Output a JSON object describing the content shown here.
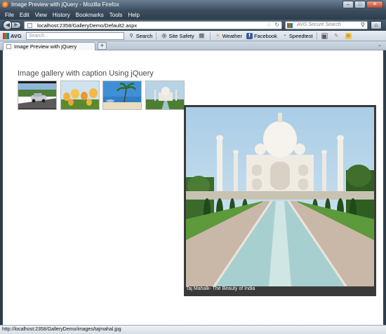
{
  "window": {
    "title": "Image Preview with jQuery - Mozilla Firefox",
    "buttons": {
      "minimize": "–",
      "maximize": "□",
      "close": "✕"
    }
  },
  "menubar": {
    "items": [
      "File",
      "Edit",
      "View",
      "History",
      "Bookmarks",
      "Tools",
      "Help"
    ]
  },
  "navbar": {
    "url": "localhost:2358/GalleryDemo/Default2.aspx",
    "search_placeholder": "AVG Secure Search",
    "back_icon": "◀",
    "forward_icon": "▶",
    "star_icon": "☆",
    "reload_icon": "↻",
    "search_icon": "⚲",
    "home_icon": "⌂"
  },
  "toolbar": {
    "brand": "AVG",
    "search_placeholder": "Search...",
    "items": {
      "search": "Search",
      "site_safety": "Site Safety",
      "weather": "Weather",
      "facebook": "Facebook",
      "speedtest": "Speedtest"
    }
  },
  "tabs": {
    "active_title": "Image Preview with jQuery",
    "new_tab_label": "+",
    "list_icon": "⌄"
  },
  "page": {
    "heading": "Image gallery with caption Using jQuery",
    "thumbnails": [
      "car-road",
      "tulips",
      "beach-palm",
      "taj-mahal"
    ],
    "preview_caption": "Taj Mahalk- The Beauty of India"
  },
  "status": {
    "text": "http://localhost:2358/GalleryDemo/images/tajmahal.jpg"
  }
}
